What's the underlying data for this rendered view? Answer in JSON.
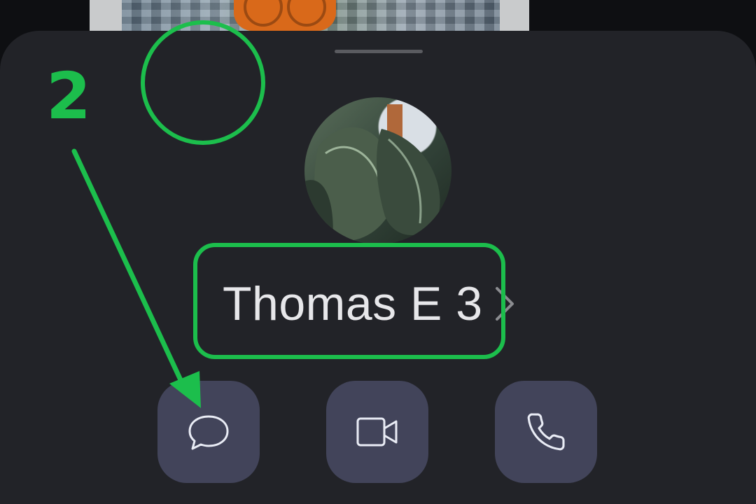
{
  "contact": {
    "name": "Thomas E 3"
  },
  "actions": [
    {
      "icon": "message-icon"
    },
    {
      "icon": "video-camera-icon"
    },
    {
      "icon": "phone-icon"
    }
  ],
  "annotation": {
    "step_number": "2",
    "color": "#1cbe4c"
  },
  "colors": {
    "sheet_background": "#222328",
    "action_button_background": "#42445a",
    "icon_stroke": "#e9ecf5",
    "name_text": "#e7e7ea"
  }
}
